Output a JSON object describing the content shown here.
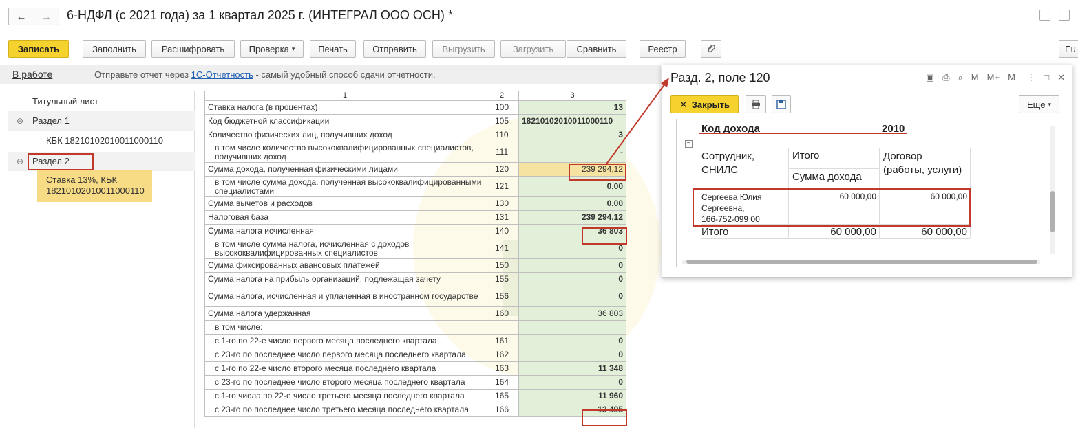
{
  "window": {
    "title": "6-НДФЛ (с 2021 года) за 1 квартал 2025 г. (ИНТЕГРАЛ ООО ОСН) *",
    "back_glyph": "←",
    "forward_glyph": "→"
  },
  "toolbar": {
    "save": "Записать",
    "fill": "Заполнить",
    "decode": "Расшифровать",
    "check": "Проверка",
    "print": "Печать",
    "send": "Отправить",
    "export": "Выгрузить",
    "import": "Загрузить",
    "compare": "Сравнить",
    "registry": "Реестр",
    "more_cut": "Eu"
  },
  "infobar": {
    "status": "В работе",
    "prefix": "Отправьте отчет через ",
    "link": "1С-Отчетность",
    "suffix": " - самый удобный способ сдачи отчетности."
  },
  "nav": {
    "title_page": "Титульный лист",
    "section1": "Раздел 1",
    "kbk1": "КБК 18210102010011000110",
    "section2": "Раздел 2",
    "selected_line1": "Ставка 13%, КБК",
    "selected_line2": "18210102010011000110"
  },
  "table": {
    "headers": [
      "1",
      "2",
      "3"
    ],
    "rows": [
      {
        "label": "Ставка налога (в процентах)",
        "code": "100",
        "value": "13"
      },
      {
        "label": "Код бюджетной классификации",
        "code": "105",
        "value": "18210102010011000110"
      },
      {
        "label": "Количество физических лиц, получивших доход",
        "code": "110",
        "value": "3"
      },
      {
        "label": "в том числе количество высококвалифицированных специалистов, получивших доход",
        "code": "111",
        "value": "-"
      },
      {
        "label": "Сумма дохода, полученная физическими лицами",
        "code": "120",
        "value": "239 294,12"
      },
      {
        "label": "в том числе сумма дохода, полученная высококвалифицированными специалистами",
        "code": "121",
        "value": "0,00"
      },
      {
        "label": "Сумма вычетов и расходов",
        "code": "130",
        "value": "0,00"
      },
      {
        "label": "Налоговая база",
        "code": "131",
        "value": "239 294,12"
      },
      {
        "label": "Сумма налога исчисленная",
        "code": "140",
        "value": "36 803"
      },
      {
        "label": "в том числе сумма налога, исчисленная с доходов высококвалифицированных специалистов",
        "code": "141",
        "value": "0"
      },
      {
        "label": "Сумма фиксированных авансовых платежей",
        "code": "150",
        "value": "0"
      },
      {
        "label": "Сумма налога на прибыль организаций, подлежащая зачету",
        "code": "155",
        "value": "0"
      },
      {
        "label": "Сумма налога, исчисленная и уплаченная в иностранном государстве",
        "code": "156",
        "value": "0"
      },
      {
        "label": "Сумма налога удержанная",
        "code": "160",
        "value": "36 803"
      },
      {
        "label": "в том числе:",
        "code": "",
        "value": ""
      },
      {
        "label": "с 1-го по 22-е число первого месяца последнего квартала",
        "code": "161",
        "value": "0"
      },
      {
        "label": "с 23-го по последнее число первого месяца последнего квартала",
        "code": "162",
        "value": "0"
      },
      {
        "label": "с 1-го по 22-е число второго месяца последнего квартала",
        "code": "163",
        "value": "11 348"
      },
      {
        "label": "с 23-го по последнее число второго месяца последнего квартала",
        "code": "164",
        "value": "0"
      },
      {
        "label": "с 1-го числа по 22-е число третьего месяца последнего квартала",
        "code": "165",
        "value": "11 960"
      },
      {
        "label": "с 23-го по последнее число третьего месяца последнего квартала",
        "code": "166",
        "value": "13 495"
      }
    ]
  },
  "popup": {
    "title": "Разд. 2, поле 120",
    "close": "Закрыть",
    "more": "Еще",
    "icons": [
      "M",
      "M+",
      "M-"
    ],
    "income_code_label": "Код дохода",
    "income_code_value": "2010",
    "col_employee": "Сотрудник, СНИЛС",
    "col_total": "Итого",
    "col_income_sum": "Сумма дохода",
    "col_contract": "Договор (работы, услуги)",
    "employee_line1": "Сергеева Юлия",
    "employee_line2": "Сергеевна,",
    "employee_line3": "166-752-099 00",
    "employee_total": "60 000,00",
    "employee_contract": "60 000,00",
    "footer_label": "Итого",
    "footer_total": "60 000,00",
    "footer_contract": "60 000,00"
  },
  "colors": {
    "accent_yellow": "#f5d22e",
    "highlight_red": "#c0392b",
    "cell_green": "#e2efd9",
    "nav_selected": "#f7dc85",
    "link_blue": "#1f5fb5"
  }
}
